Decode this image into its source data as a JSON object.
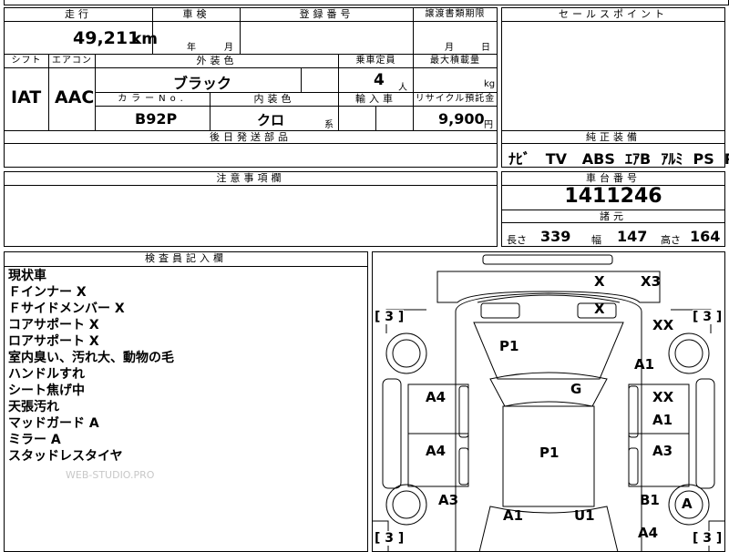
{
  "top_strip": {
    "partial_text": "…"
  },
  "mileage": {
    "header": "走行",
    "value": "49,211",
    "unit": "km"
  },
  "inspection": {
    "header": "車検",
    "year_label": "年",
    "month_label": "月"
  },
  "registration": {
    "header": "登録番号"
  },
  "transfer": {
    "header": "譲渡書類期限",
    "month_label": "月",
    "day_label": "日"
  },
  "sales_point": {
    "header": "セールスポイント"
  },
  "shift": {
    "header": "シフト",
    "value": "IAT"
  },
  "aircon": {
    "header": "エアコン",
    "value": "AAC"
  },
  "exterior_color": {
    "header": "外装色",
    "value": "ブラック"
  },
  "capacity": {
    "header": "乗車定員",
    "value": "4",
    "unit": "人"
  },
  "max_load": {
    "header": "最大積載量",
    "unit": "kg"
  },
  "color_no": {
    "header": "カラーNo.",
    "value": "B92P"
  },
  "interior_color": {
    "header": "内装色",
    "value": "クロ",
    "suffix": "系"
  },
  "import": {
    "header": "輸入車"
  },
  "recycle": {
    "header": "リサイクル預託金",
    "value": "9,900",
    "unit": "円"
  },
  "later_parts": {
    "header": "後日発送部品"
  },
  "genuine_equipment": {
    "header": "純正装備",
    "items": [
      "ﾅﾋﾞ",
      "TV",
      "ABS",
      "ｴｱB",
      "ｱﾙﾐ",
      "PS",
      "PW"
    ]
  },
  "caution": {
    "header": "注意事項欄"
  },
  "chassis_number": {
    "header": "車台番号",
    "value": "1411246"
  },
  "specs": {
    "header": "諸元",
    "length_label": "長さ",
    "length": "339",
    "width_label": "幅",
    "width": "147",
    "height_label": "高さ",
    "height": "164"
  },
  "inspector_notes": {
    "header": "検査員記入欄",
    "lines": [
      "現状車",
      "Ｆインナー X",
      "Ｆサイドメンバー X",
      "コアサポート X",
      "ロアサポート X",
      "室内臭い、汚れ大、動物の毛",
      "ハンドルすれ",
      "シート焦げ中",
      "天張汚れ",
      "マッドガード A",
      "ミラー A",
      "スタッドレスタイヤ"
    ],
    "watermark": "WEB-STUDIO.PRO"
  },
  "damage_map": {
    "tire_tread": "3",
    "marks": {
      "front_top": "X",
      "front_right_corner": "X3",
      "front_inner": "X",
      "right_front_fender_top": "XX",
      "hood": "P1",
      "right_front_fender": "A1",
      "windshield": "G",
      "left_front_door": "A4",
      "right_front_door_1": "XX",
      "right_front_door_2": "A1",
      "left_rear_door": "A4",
      "roof": "P1",
      "right_rear_door": "A3",
      "left_rear_quarter": "A3",
      "right_rear_quarter": "B1",
      "right_rear_wheel": "A",
      "rear_left": "A1",
      "rear_right": "U1",
      "rear_right_corner": "A4"
    }
  }
}
